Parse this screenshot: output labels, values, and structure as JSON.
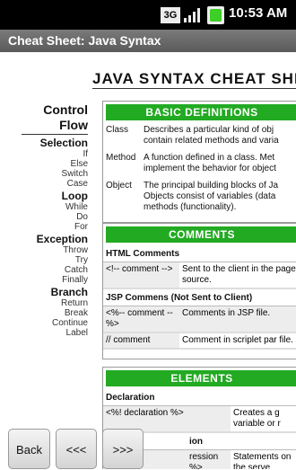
{
  "status": {
    "network": "3G",
    "time": "10:53 AM"
  },
  "title_bar": "Cheat Sheet: Java Syntax",
  "doc_title": "JAVA SYNTAX CHEAT SHEET",
  "nav": [
    {
      "label": "Control",
      "style": "top"
    },
    {
      "label": "Flow",
      "style": "top"
    },
    {
      "label": "Selection",
      "style": "head"
    },
    {
      "label": "If",
      "style": "sub"
    },
    {
      "label": "Else",
      "style": "sub"
    },
    {
      "label": "Switch",
      "style": "sub"
    },
    {
      "label": "Case",
      "style": "sub"
    },
    {
      "label": "Loop",
      "style": "head"
    },
    {
      "label": "While",
      "style": "sub"
    },
    {
      "label": "Do",
      "style": "sub"
    },
    {
      "label": "For",
      "style": "sub"
    },
    {
      "label": "Exception",
      "style": "head"
    },
    {
      "label": "Throw",
      "style": "sub"
    },
    {
      "label": "Try",
      "style": "sub"
    },
    {
      "label": "Catch",
      "style": "sub"
    },
    {
      "label": "Finally",
      "style": "sub"
    },
    {
      "label": "Branch",
      "style": "head"
    },
    {
      "label": "Return",
      "style": "sub"
    },
    {
      "label": "Break",
      "style": "sub"
    },
    {
      "label": "Continue",
      "style": "sub"
    },
    {
      "label": "Label",
      "style": "sub"
    }
  ],
  "basic": {
    "header": "BASIC DEFINITIONS",
    "rows": [
      {
        "term": "Class",
        "def": "Describes a particular kind of obj contain related methods and varia"
      },
      {
        "term": "Method",
        "def": "A function defined in a class. Met implement the behavior for object"
      },
      {
        "term": "Object",
        "def": "The principal building blocks of Ja Objects consist of variables (data methods (functionality)."
      }
    ]
  },
  "comments": {
    "header": "COMMENTS",
    "html_title": "HTML Comments",
    "html_rows": [
      {
        "k": "<!-- comment -->",
        "v": "Sent to the client in the page source."
      }
    ],
    "jsp_title": "JSP Commens (Not Sent to Client)",
    "jsp_rows": [
      {
        "k": "<%-- comment --%>",
        "v": "Comments in JSP file."
      },
      {
        "k": "// comment",
        "v": "Comment in scriplet par file."
      }
    ]
  },
  "elements": {
    "header": "ELEMENTS",
    "decl_title": "Declaration",
    "decl_rows": [
      {
        "k": "<%! declaration %>",
        "v": "Creates a g variable or r"
      }
    ],
    "partial_title": "ion",
    "partial_rows": [
      {
        "k": "ression %>",
        "v": "Statements on the serve"
      }
    ]
  },
  "buttons": {
    "back": "Back",
    "prev": "<<<",
    "next": ">>>"
  }
}
